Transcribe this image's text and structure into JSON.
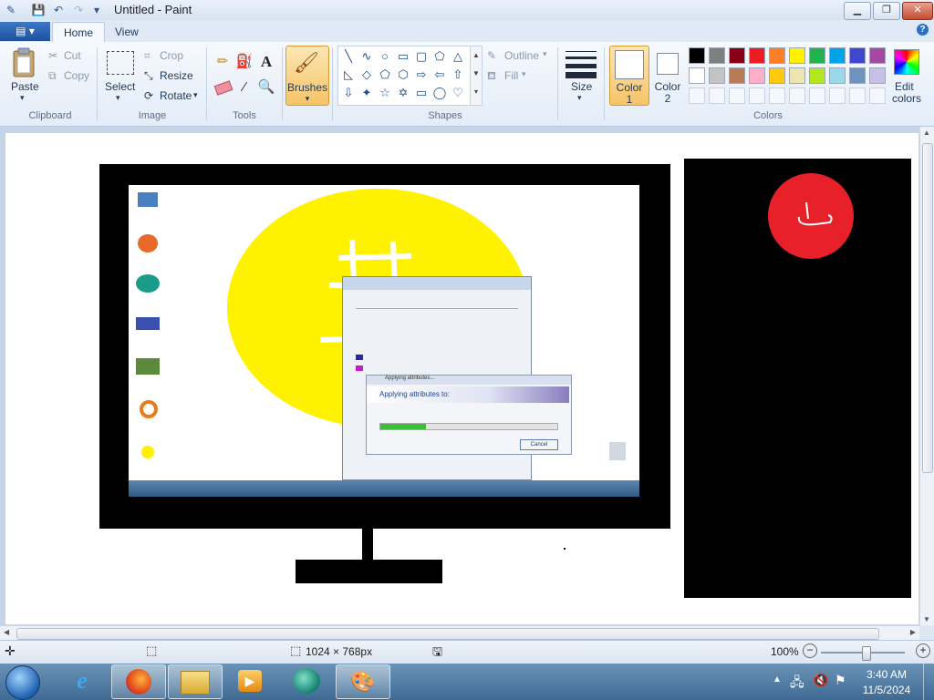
{
  "window": {
    "title": "Untitled - Paint",
    "minimize_label": "▁",
    "maximize_label": "❐",
    "close_label": "✕"
  },
  "ribbon": {
    "file_menu_label": "▤ ▾",
    "tabs": [
      {
        "label": "Home"
      },
      {
        "label": "View"
      }
    ],
    "help_label": "?",
    "clipboard": {
      "paste": "Paste",
      "cut": "Cut",
      "copy": "Copy",
      "group": "Clipboard"
    },
    "image": {
      "select": "Select",
      "crop": "Crop",
      "resize": "Resize",
      "rotate": "Rotate",
      "group": "Image"
    },
    "tools": {
      "group": "Tools"
    },
    "brushes": {
      "label": "Brushes"
    },
    "shapes": {
      "outline": "Outline",
      "fill": "Fill",
      "group": "Shapes"
    },
    "size": {
      "label": "Size"
    },
    "color1": {
      "label": "Color",
      "number": "1"
    },
    "color2": {
      "label": "Color",
      "number": "2"
    },
    "colors": {
      "group": "Colors",
      "edit": "Edit",
      "edit2": "colors"
    },
    "palette_row1": [
      "#000000",
      "#7f7f7f",
      "#880015",
      "#ed1c24",
      "#ff7f27",
      "#fff200",
      "#22b14c",
      "#00a2e8",
      "#3f48cc",
      "#a349a4"
    ],
    "palette_row2": [
      "#ffffff",
      "#c3c3c3",
      "#b97a57",
      "#ffaec9",
      "#ffc90e",
      "#efe4b0",
      "#b5e61d",
      "#99d9ea",
      "#7092be",
      "#c8bfe7"
    ]
  },
  "drawing": {
    "inner_dialog_title": "Applying attributes...",
    "inner_dialog_heading": "Applying attributes to:",
    "inner_dialog_cancel": "Cancel"
  },
  "status": {
    "dimensions": "1024 × 768px",
    "zoom": "100%"
  },
  "taskbar": {
    "time": "3:40 AM",
    "date": "11/5/2024"
  }
}
